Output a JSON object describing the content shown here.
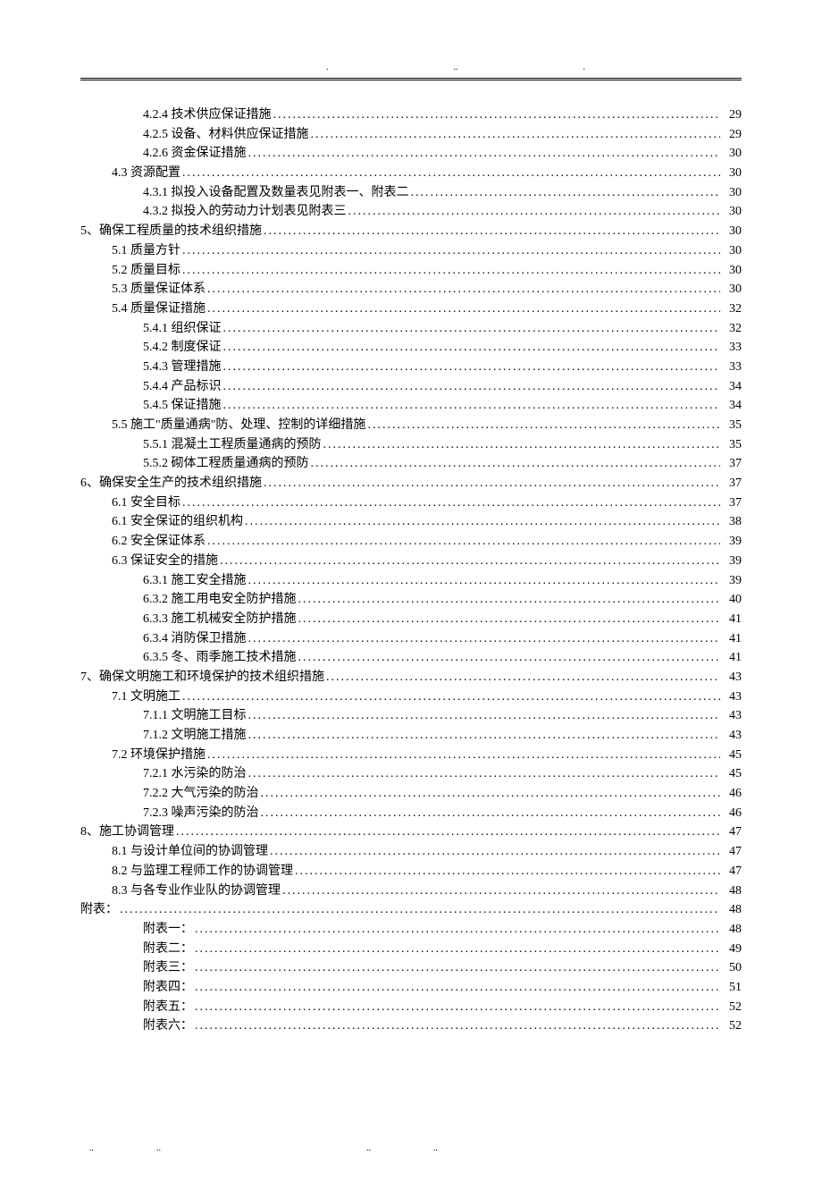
{
  "header_marks": [
    ".",
    "..",
    "."
  ],
  "footer_marks": [
    "..",
    "..",
    "..",
    ".."
  ],
  "toc": [
    {
      "indent": 2,
      "text": "4.2.4 技术供应保证措施",
      "page": "29"
    },
    {
      "indent": 2,
      "text": "4.2.5 设备、材料供应保证措施",
      "page": "29"
    },
    {
      "indent": 2,
      "text": "4.2.6 资金保证措施",
      "page": "30"
    },
    {
      "indent": 1,
      "text": "4.3 资源配置",
      "page": "30"
    },
    {
      "indent": 2,
      "text": "4.3.1 拟投入设备配置及数量表见附表一、附表二",
      "page": "30"
    },
    {
      "indent": 2,
      "text": "4.3.2 拟投入的劳动力计划表见附表三",
      "page": "30"
    },
    {
      "indent": 0,
      "text": "5、确保工程质量的技术组织措施",
      "page": "30"
    },
    {
      "indent": 1,
      "text": "5.1 质量方针",
      "page": "30"
    },
    {
      "indent": 1,
      "text": "5.2 质量目标",
      "page": "30"
    },
    {
      "indent": 1,
      "text": "5.3 质量保证体系",
      "page": "30"
    },
    {
      "indent": 1,
      "text": "5.4 质量保证措施",
      "page": "32"
    },
    {
      "indent": 2,
      "text": "5.4.1 组织保证",
      "page": "32"
    },
    {
      "indent": 2,
      "text": "5.4.2 制度保证",
      "page": "33"
    },
    {
      "indent": 2,
      "text": "5.4.3 管理措施",
      "page": "33"
    },
    {
      "indent": 2,
      "text": "5.4.4 产品标识",
      "page": "34"
    },
    {
      "indent": 2,
      "text": "5.4.5 保证措施",
      "page": "34"
    },
    {
      "indent": 1,
      "text": "5.5 施工\"质量通病\"防、处理、控制的详细措施",
      "page": "35"
    },
    {
      "indent": 2,
      "text": "5.5.1 混凝土工程质量通病的预防",
      "page": "35"
    },
    {
      "indent": 2,
      "text": "5.5.2 砌体工程质量通病的预防",
      "page": "37"
    },
    {
      "indent": 0,
      "text": "6、确保安全生产的技术组织措施",
      "page": "37"
    },
    {
      "indent": 1,
      "text": "6.1 安全目标",
      "page": "37"
    },
    {
      "indent": 1,
      "text": "6.1 安全保证的组织机构",
      "page": "38"
    },
    {
      "indent": 1,
      "text": "6.2 安全保证体系",
      "page": "39"
    },
    {
      "indent": 1,
      "text": "6.3 保证安全的措施",
      "page": "39"
    },
    {
      "indent": 2,
      "text": "6.3.1 施工安全措施",
      "page": "39"
    },
    {
      "indent": 2,
      "text": "6.3.2 施工用电安全防护措施",
      "page": "40"
    },
    {
      "indent": 2,
      "text": "6.3.3 施工机械安全防护措施",
      "page": "41"
    },
    {
      "indent": 2,
      "text": "6.3.4 消防保卫措施",
      "page": "41"
    },
    {
      "indent": 2,
      "text": "6.3.5 冬、雨季施工技术措施",
      "page": "41"
    },
    {
      "indent": 0,
      "text": "7、确保文明施工和环境保护的技术组织措施",
      "page": "43"
    },
    {
      "indent": 1,
      "text": "7.1 文明施工",
      "page": "43"
    },
    {
      "indent": 2,
      "text": "7.1.1 文明施工目标",
      "page": "43"
    },
    {
      "indent": 2,
      "text": "7.1.2 文明施工措施",
      "page": "43"
    },
    {
      "indent": 1,
      "text": "7.2 环境保护措施",
      "page": "45"
    },
    {
      "indent": 2,
      "text": "7.2.1 水污染的防治",
      "page": "45"
    },
    {
      "indent": 2,
      "text": "7.2.2 大气污染的防治",
      "page": "46"
    },
    {
      "indent": 2,
      "text": "7.2.3 噪声污染的防治",
      "page": "46"
    },
    {
      "indent": 0,
      "text": "8、施工协调管理",
      "page": "47"
    },
    {
      "indent": 1,
      "text": "8.1 与设计单位间的协调管理",
      "page": "47"
    },
    {
      "indent": 1,
      "text": "8.2 与监理工程师工作的协调管理",
      "page": "47"
    },
    {
      "indent": 1,
      "text": "8.3 与各专业作业队的协调管理",
      "page": "48"
    },
    {
      "indent": 0,
      "text": "附表：",
      "page": "48"
    },
    {
      "indent": 2,
      "text": "附表一：",
      "page": "48"
    },
    {
      "indent": 2,
      "text": "附表二：",
      "page": "49"
    },
    {
      "indent": 2,
      "text": "附表三：",
      "page": "50"
    },
    {
      "indent": 2,
      "text": "附表四：",
      "page": "51"
    },
    {
      "indent": 2,
      "text": "附表五：",
      "page": "52"
    },
    {
      "indent": 2,
      "text": "附表六：",
      "page": "52"
    }
  ]
}
